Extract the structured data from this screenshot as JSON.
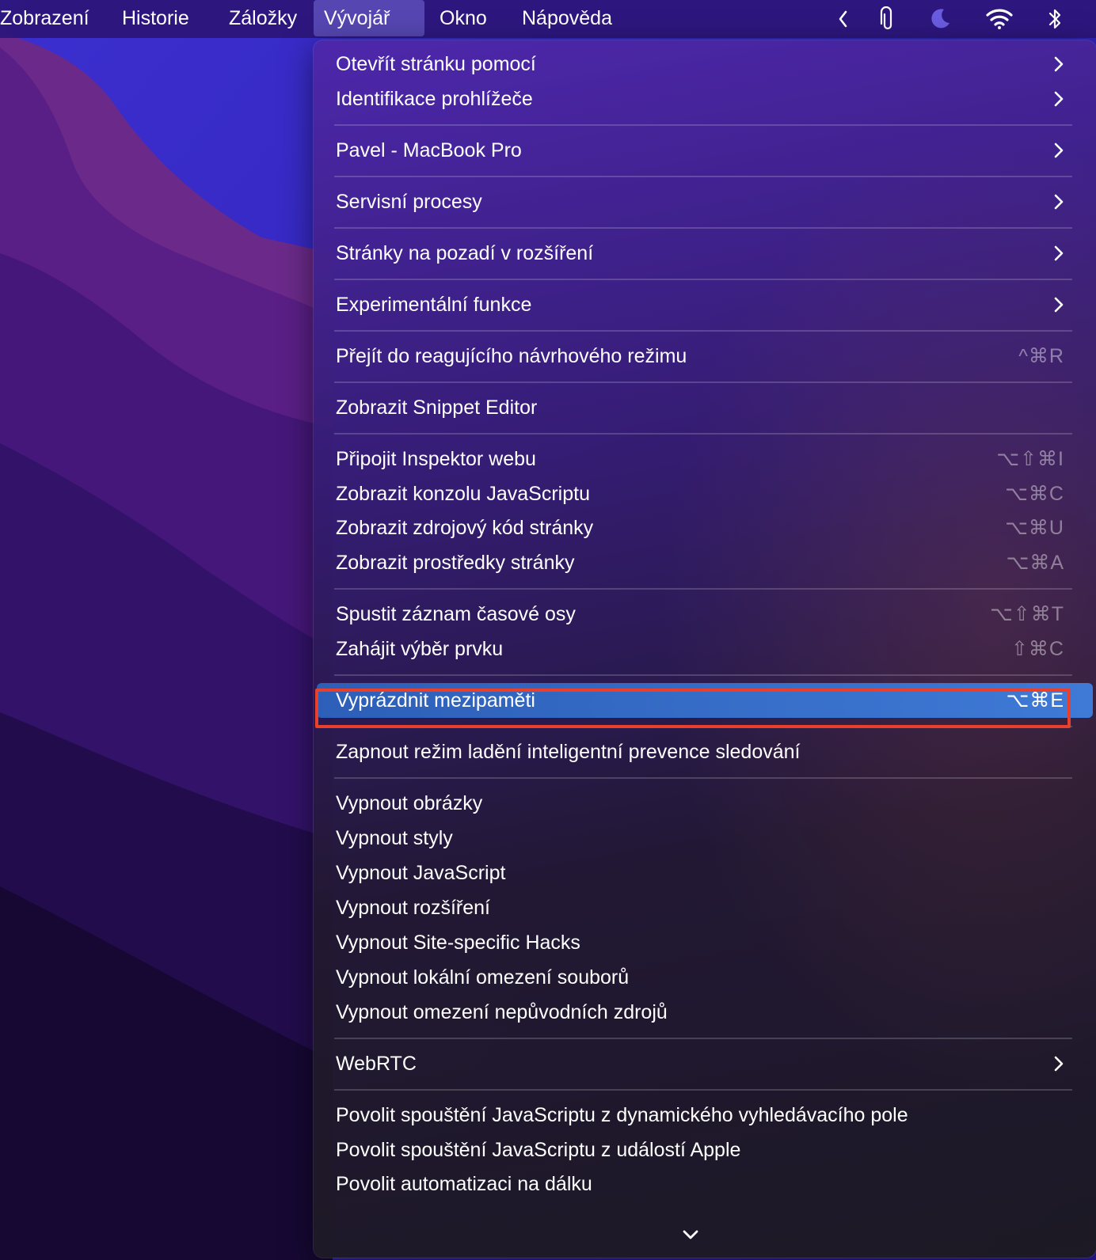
{
  "menubar": {
    "items": [
      "Zobrazení",
      "Historie",
      "Záložky",
      "Vývojář",
      "Okno",
      "Nápověda"
    ],
    "active": "Vývojář",
    "status_icons": [
      "chevron-left-icon",
      "paperclip-icon",
      "moon-icon",
      "wifi-icon",
      "bluetooth-icon"
    ]
  },
  "menu": {
    "items": [
      {
        "label": "Otevřít stránku pomocí",
        "submenu": true
      },
      {
        "label": "Identifikace prohlížeče",
        "submenu": true
      },
      {
        "label": "Pavel - MacBook Pro",
        "submenu": true
      },
      {
        "label": "Servisní procesy",
        "submenu": true
      },
      {
        "label": "Stránky na pozadí v rozšíření",
        "submenu": true
      },
      {
        "label": "Experimentální funkce",
        "submenu": true
      },
      {
        "label": "Přejít do reagujícího návrhového režimu",
        "shortcut": "^⌘R"
      },
      {
        "label": "Zobrazit Snippet Editor"
      },
      {
        "label": "Připojit Inspektor webu",
        "shortcut": "⌥⇧⌘I"
      },
      {
        "label": "Zobrazit konzolu JavaScriptu",
        "shortcut": "⌥⌘C"
      },
      {
        "label": "Zobrazit zdrojový kód stránky",
        "shortcut": "⌥⌘U"
      },
      {
        "label": "Zobrazit prostředky stránky",
        "shortcut": "⌥⌘A"
      },
      {
        "label": "Spustit záznam časové osy",
        "shortcut": "⌥⇧⌘T"
      },
      {
        "label": "Zahájit výběr prvku",
        "shortcut": "⇧⌘C"
      },
      {
        "label": "Vyprázdnit mezipaměti",
        "shortcut": "⌥⌘E",
        "highlighted": true
      },
      {
        "label": "Zapnout režim ladění inteligentní prevence sledování"
      },
      {
        "label": "Vypnout obrázky"
      },
      {
        "label": "Vypnout styly"
      },
      {
        "label": "Vypnout JavaScript"
      },
      {
        "label": "Vypnout rozšíření"
      },
      {
        "label": "Vypnout Site-specific Hacks"
      },
      {
        "label": "Vypnout lokální omezení souborů"
      },
      {
        "label": "Vypnout omezení nepůvodních zdrojů"
      },
      {
        "label": "WebRTC",
        "submenu": true
      },
      {
        "label": "Povolit spouštění JavaScriptu z dynamického vyhledávacího pole"
      },
      {
        "label": "Povolit spouštění JavaScriptu z událostí Apple"
      },
      {
        "label": "Povolit automatizaci na dálku"
      }
    ]
  },
  "colors": {
    "highlight": "#3569c4",
    "annotation_outline": "#e8402c",
    "menubar_bg": "#2d1678"
  }
}
